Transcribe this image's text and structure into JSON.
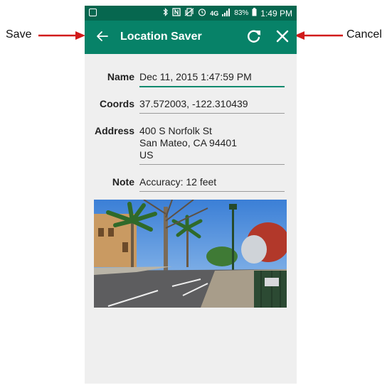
{
  "annotations": {
    "save_label": "Save",
    "cancel_label": "Cancel",
    "arrow_color": "#d11a1a"
  },
  "status_bar": {
    "time": "1:49 PM",
    "battery": "83%",
    "network": "4G",
    "icons": [
      "image-icon",
      "bluetooth-icon",
      "nfc-icon",
      "vibrate-icon",
      "alarm-icon",
      "signal-icon",
      "battery-icon"
    ]
  },
  "app_bar": {
    "title": "Location Saver",
    "color": "#078268",
    "icons": [
      "back-arrow-icon",
      "refresh-icon",
      "close-icon"
    ]
  },
  "form": {
    "name_label": "Name",
    "name_value": "Dec 11, 2015 1:47:59 PM",
    "coords_label": "Coords",
    "coords_value": "37.572003, -122.310439",
    "address_label": "Address",
    "address_line1": "400 S Norfolk St",
    "address_line2": "San Mateo, CA 94401",
    "address_line3": "US",
    "note_label": "Note",
    "note_value": "Accuracy: 12 feet"
  }
}
